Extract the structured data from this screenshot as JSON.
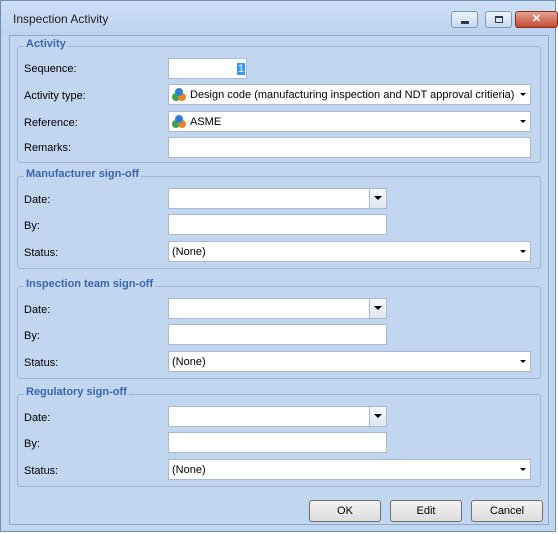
{
  "window": {
    "title": "Inspection Activity"
  },
  "activity": {
    "title": "Activity",
    "sequence_label": "Sequence:",
    "sequence_value": "1",
    "type_label": "Activity type:",
    "type_value": "Design code (manufacturing inspection and NDT approval critieria)",
    "reference_label": "Reference:",
    "reference_value": "ASME",
    "remarks_label": "Remarks:",
    "remarks_value": ""
  },
  "manufacturer": {
    "title": "Manufacturer sign-off",
    "date_label": "Date:",
    "date_value": "",
    "by_label": "By:",
    "by_value": "",
    "status_label": "Status:",
    "status_value": "(None)"
  },
  "inspection": {
    "title": "Inspection team sign-off",
    "date_label": "Date:",
    "date_value": "",
    "by_label": "By:",
    "by_value": "",
    "status_label": "Status:",
    "status_value": "(None)"
  },
  "regulatory": {
    "title": "Regulatory sign-off",
    "date_label": "Date:",
    "date_value": "",
    "by_label": "By:",
    "by_value": "",
    "status_label": "Status:",
    "status_value": "(None)"
  },
  "buttons": {
    "ok": "OK",
    "edit": "Edit",
    "cancel": "Cancel"
  },
  "icons": {
    "type_icon": "shapes-icon",
    "reference_icon": "shapes-icon"
  },
  "colors": {
    "group_title": "#3a67ad",
    "background": "#c2d6f0",
    "selection": "#3399ff"
  }
}
